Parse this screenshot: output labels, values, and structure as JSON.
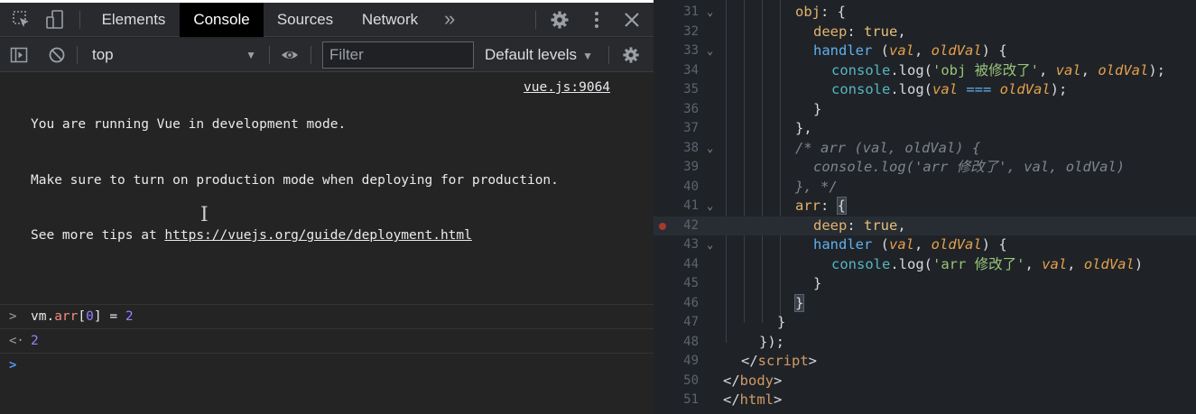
{
  "devtools": {
    "tabs": [
      {
        "label": "Elements",
        "active": false
      },
      {
        "label": "Console",
        "active": true
      },
      {
        "label": "Sources",
        "active": false
      },
      {
        "label": "Network",
        "active": false
      }
    ],
    "more_tabs_label": "»",
    "context": "top",
    "filter_placeholder": "Filter",
    "levels_label": "Default levels",
    "messages": {
      "vue_line1": "You are running Vue in development mode.",
      "vue_line2": "Make sure to turn on production mode when deploying for production.",
      "vue_line3_prefix": "See more tips at ",
      "vue_link": "https://vuejs.org/guide/deployment.html",
      "vue_source": "vue.js:9064",
      "input_obj": "vm",
      "input_dot": ".",
      "input_prop": "arr",
      "input_index_open": "[",
      "input_index": "0",
      "input_index_close": "]",
      "input_assign": " = ",
      "input_value": "2",
      "result": "2",
      "input_gutter": ">",
      "result_gutter": "<·",
      "prompt_gutter": ">"
    },
    "icons": [
      "inspect-icon",
      "device-toggle-icon",
      "settings-gear-icon",
      "kebab-menu-icon",
      "close-icon",
      "sidebar-toggle-icon",
      "clear-console-icon",
      "eye-icon",
      "console-settings-gear-icon"
    ]
  },
  "editor": {
    "line_numbers": [
      "31",
      "32",
      "33",
      "34",
      "35",
      "36",
      "37",
      "38",
      "39",
      "40",
      "41",
      "42",
      "43",
      "44",
      "45",
      "46",
      "47",
      "48",
      "49",
      "50",
      "51"
    ],
    "t": {
      "obj": "obj",
      "colon_brace": ": {",
      "deep": "deep",
      "colon": ": ",
      "true": "true",
      "comma": ",",
      "handler": "handler",
      "open": " (",
      "val": "val",
      "sep": ", ",
      "oldVal": "oldVal",
      "close_brace": ") {",
      "console": "console",
      "log": ".log(",
      "str_obj": "'obj 被修改了'",
      "end_call": ");",
      "eqq": " === ",
      "rbrace": "}",
      "rbrace_comma": "},",
      "cmt1": "/* arr (val, oldVal) {",
      "cmt2": "console.log('arr 修改了', val, oldVal)",
      "cmt3": "}, */",
      "arr": "arr",
      "colon_sp": ": ",
      "lbrace": "{",
      "str_arr": "'arr 修改了'",
      "paren_close": ")",
      "end_obj": "});",
      "lt_slash": "</",
      "script": "script",
      "gt": ">",
      "body": "body",
      "html": "html"
    }
  },
  "colors": {
    "console_bg": "#242424",
    "editor_bg": "#1f2327",
    "accent_blue": "#4e96f2",
    "number_purple": "#9980ff",
    "prop_red": "#f28b82"
  }
}
